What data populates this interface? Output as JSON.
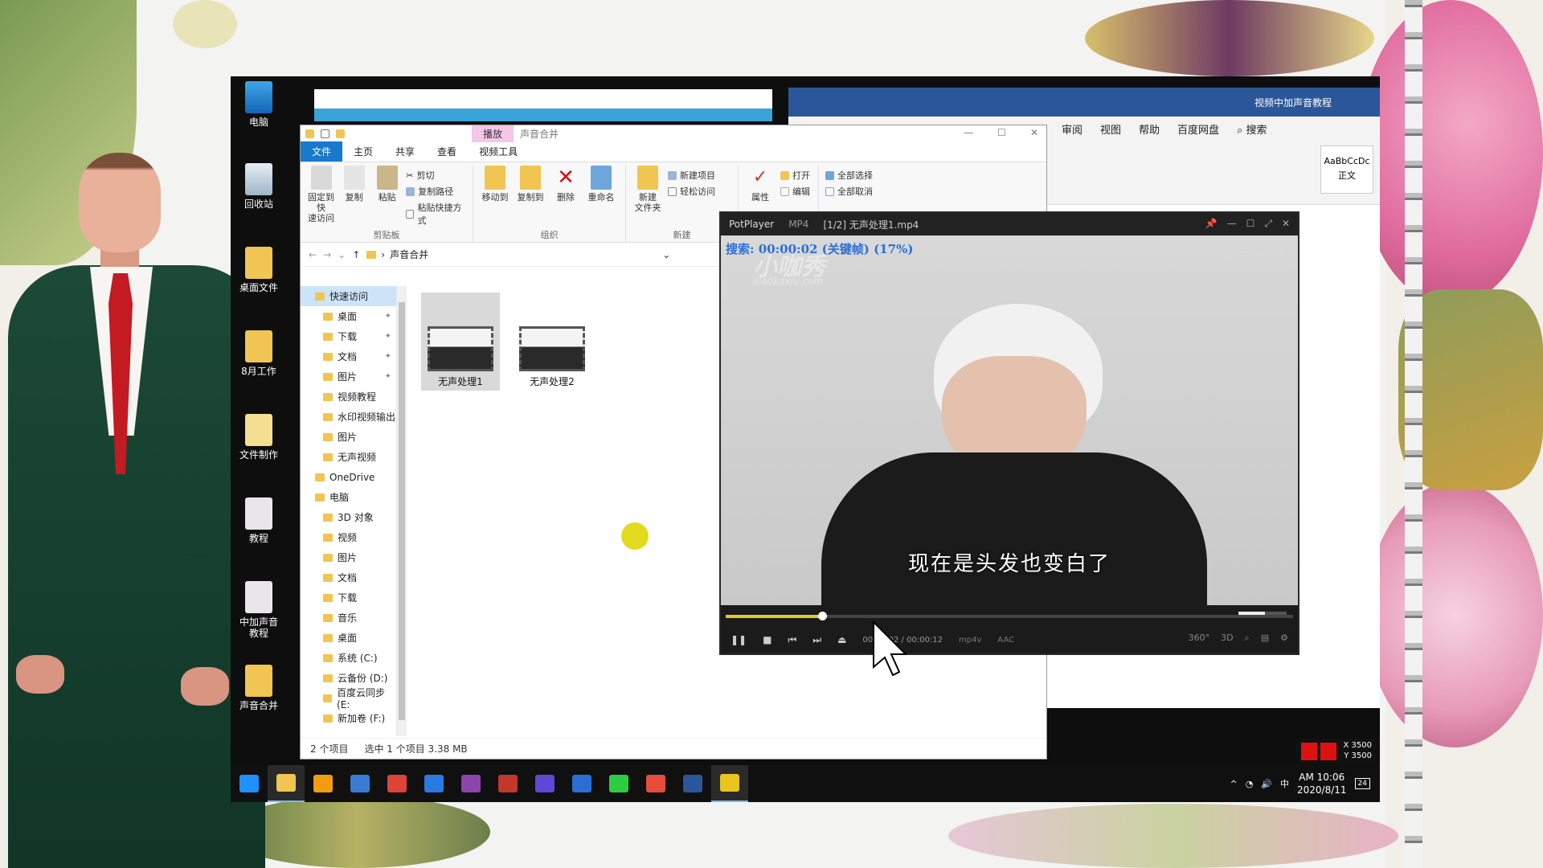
{
  "desktop_icons": [
    {
      "label": "电脑",
      "icon": "computer-icon"
    },
    {
      "label": "回收站",
      "icon": "recycle-bin-icon"
    },
    {
      "label": "桌面文件",
      "icon": "folder-icon"
    },
    {
      "label": "8月工作",
      "icon": "folder-icon"
    },
    {
      "label": "文件制作",
      "icon": "folder-icon"
    },
    {
      "label": "教程",
      "icon": "folder-icon"
    },
    {
      "label": "中加声音\n教程",
      "icon": "folder-icon"
    },
    {
      "label": "声音合并",
      "icon": "folder-icon"
    }
  ],
  "explorer": {
    "context_tab": "播放",
    "context_title": "声音合并",
    "tabs": [
      "文件",
      "主页",
      "共享",
      "查看",
      "视频工具"
    ],
    "ribbon": {
      "pin_quick": "固定到快\n速访问",
      "copy": "复制",
      "paste": "粘贴",
      "cut": "剪切",
      "copy_path": "复制路径",
      "paste_shortcut": "粘贴快捷方式",
      "group_clipboard": "剪贴板",
      "move_to": "移动到",
      "copy_to": "复制到",
      "delete": "删除",
      "rename": "重命名",
      "group_organize": "组织",
      "new_folder": "新建\n文件夹",
      "new_item": "新建项目",
      "easy_access": "轻松访问",
      "group_new": "新建",
      "properties": "属性",
      "open": "打开",
      "edit": "编辑",
      "select_all": "全部选择",
      "select_none": "全部取消"
    },
    "address": "声音合并",
    "nav": [
      {
        "label": "快速访问",
        "level": 0,
        "selected": true
      },
      {
        "label": "桌面",
        "level": 1,
        "pinned": true
      },
      {
        "label": "下载",
        "level": 1,
        "pinned": true
      },
      {
        "label": "文档",
        "level": 1,
        "pinned": true
      },
      {
        "label": "图片",
        "level": 1,
        "pinned": true
      },
      {
        "label": "视频教程",
        "level": 1
      },
      {
        "label": "水印视频输出",
        "level": 1
      },
      {
        "label": "图片",
        "level": 1
      },
      {
        "label": "无声视频",
        "level": 1
      },
      {
        "label": "OneDrive",
        "level": 0
      },
      {
        "label": "电脑",
        "level": 0
      },
      {
        "label": "3D 对象",
        "level": 1
      },
      {
        "label": "视频",
        "level": 1
      },
      {
        "label": "图片",
        "level": 1
      },
      {
        "label": "文档",
        "level": 1
      },
      {
        "label": "下载",
        "level": 1
      },
      {
        "label": "音乐",
        "level": 1
      },
      {
        "label": "桌面",
        "level": 1
      },
      {
        "label": "系统 (C:)",
        "level": 1
      },
      {
        "label": "云备份 (D:)",
        "level": 1
      },
      {
        "label": "百度云同步 (E:",
        "level": 1
      },
      {
        "label": "新加卷 (F:)",
        "level": 1
      }
    ],
    "files": [
      {
        "name": "无声处理1",
        "selected": true
      },
      {
        "name": "无声处理2",
        "selected": false
      }
    ],
    "status": {
      "count": "2 个项目",
      "selection": "选中 1 个项目  3.38 MB"
    }
  },
  "word": {
    "title": "视频中加声音教程",
    "menu": [
      "审阅",
      "视图",
      "帮助",
      "百度网盘",
      "搜索"
    ],
    "style_sample": "AaBbCcDc",
    "style_name": "正文"
  },
  "potplayer": {
    "brand": "PotPlayer",
    "format": "MP4",
    "title": "[1/2] 无声处理1.mp4",
    "osd": "搜索: 00:00:02 (关键帧) (17%)",
    "watermark_main": "小咖秀",
    "watermark_sub": "xiaokaxiu.com",
    "subtitle": "现在是头发也变白了",
    "time_current": "00:00:02",
    "time_total": "00:00:12",
    "video_codec": "mp4v",
    "audio_codec": "AAC",
    "progress": 0.17,
    "volume": 0.55,
    "buttons_right": [
      "360°",
      "3D"
    ]
  },
  "taskbar": {
    "clock_time": "AM 10:06",
    "clock_date": "2020/8/11",
    "notify_count": "24",
    "ime": "中",
    "coord_x": "X 3500",
    "coord_y": "Y 3500",
    "apps": [
      "start-icon",
      "file-explorer-icon",
      "app-icon",
      "browser-icon",
      "chrome-icon",
      "mail-icon",
      "app-icon",
      "app-icon",
      "app-icon",
      "app-icon",
      "app-icon",
      "app-icon",
      "word-icon",
      "folder-icon"
    ],
    "app_colors": [
      "#1e90ff",
      "#f0c552",
      "#f39c12",
      "#3a7bd5",
      "#db4437",
      "#2a7ae2",
      "#8e44ad",
      "#c0392b",
      "#5b4ad6",
      "#2b6fd6",
      "#2ecc40",
      "#e74c3c",
      "#2b579a",
      "#e8c51c"
    ]
  }
}
